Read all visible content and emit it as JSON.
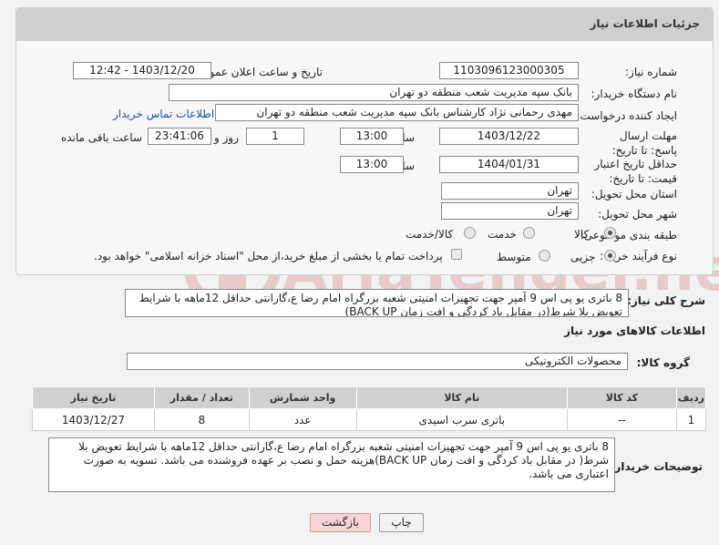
{
  "panel": {
    "title": "جزئیات اطلاعات نیاز"
  },
  "labels": {
    "need_number": "شماره نیاز:",
    "announce_datetime": "تاریخ و ساعت اعلان عمومی:",
    "buyer_org": "نام دستگاه خریدار:",
    "requester": "ایجاد کننده درخواست:",
    "reply_deadline": "مهلت ارسال پاسخ: تا تاریخ:",
    "price_validity": "حداقل تاریخ اعتبار قیمت: تا تاریخ:",
    "delivery_province": "استان محل تحویل:",
    "delivery_city": "شهر محل تحویل:",
    "category": "طبقه بندی موضوعی:",
    "purchase_type": "نوع فرآیند خرید :",
    "time": "ساعت",
    "days": "روز و",
    "remaining": "ساعت باقی مانده",
    "need_description": "شرح کلی نیاز:",
    "goods_info": "اطلاعات کالاهای مورد نیاز",
    "goods_group": "گروه کالا:",
    "buyer_notes": "توضیحات خریدار:"
  },
  "values": {
    "need_number": "1103096123000305",
    "announce_datetime": "1403/12/20 - 12:42",
    "buyer_org": "بانک سپه مدیریت شعب منطقه دو تهران",
    "requester": "مهدی رحمانی نژاد کارشناس بانک سپه مدیریت شعب منطقه دو تهران",
    "contact_link": "اطلاعات تماس خریدار",
    "reply_date": "1403/12/22",
    "reply_time": "13:00",
    "reply_days": "1",
    "reply_remaining": "23:41:06",
    "validity_date": "1404/01/31",
    "validity_time": "13:00",
    "province": "تهران",
    "city": "تهران",
    "goods_group": "محصولات الکترونیکی"
  },
  "category_options": [
    {
      "label": "کالا",
      "selected": true
    },
    {
      "label": "خدمت",
      "selected": false
    },
    {
      "label": "کالا/خدمت",
      "selected": false
    }
  ],
  "purchase_options": [
    {
      "label": "جزیی",
      "selected": true
    },
    {
      "label": "متوسط",
      "selected": false
    }
  ],
  "payment_note": "پرداخت تمام یا بخشی از مبلغ خرید،از محل \"اسناد خزانه اسلامی\" خواهد بود.",
  "need_description": "8 باتری یو پی اس 9 آمپر جهت تجهیزات امنیتی شعبه بزرگراه امام رضا ع،گارانتی حداقل 12ماهه با شرایط تعویض بلا شرط(در مقابل باد کردگی و افت زمان BACK UP)",
  "table": {
    "headers": [
      "ردیف",
      "کد کالا",
      "نام کالا",
      "واحد شمارش",
      "تعداد / مقدار",
      "تاریخ نیاز"
    ],
    "rows": [
      [
        "1",
        "--",
        "باتری سرب اسیدی",
        "عدد",
        "8",
        "1403/12/27"
      ]
    ]
  },
  "buyer_notes": "8 باتری یو پی اس 9 آمپر جهت تجهیزات امنیتی شعبه بزرگراه امام رضا ع،گارانتی حداقل 12ماهه با شرایط تعویض بلا شرط( در مقابل باد کردگی و افت زمان BACK UP)هزینه حمل و نصب بر عهده فروشنده می باشد.  تسویه به صورت اعتباری می باشد.",
  "buttons": {
    "print": "چاپ",
    "back": "بازگشت"
  },
  "watermark": "AriaTender.neT",
  "colors": {
    "link": "#1a4fb5",
    "back_button": "#f7d4d4",
    "header": "#cfcfcf"
  }
}
